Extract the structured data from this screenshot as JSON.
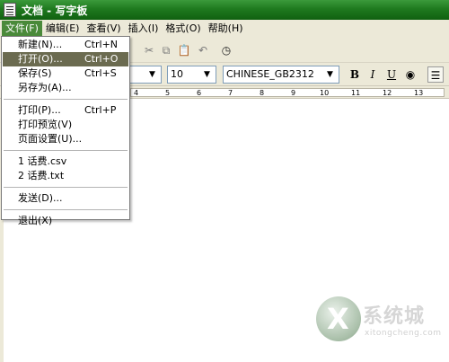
{
  "window": {
    "title": "文档 - 写字板"
  },
  "menubar": [
    "文件(F)",
    "编辑(E)",
    "查看(V)",
    "插入(I)",
    "格式(O)",
    "帮助(H)"
  ],
  "format": {
    "size": "10",
    "charset": "CHINESE_GB2312",
    "bold": "B",
    "italic": "I",
    "underline": "U"
  },
  "ruler": [
    "4",
    "5",
    "6",
    "7",
    "8",
    "9",
    "10",
    "11",
    "12",
    "13"
  ],
  "file_menu": {
    "group1": [
      {
        "label": "新建(N)...",
        "shortcut": "Ctrl+N"
      },
      {
        "label": "打开(O)...",
        "shortcut": "Ctrl+O"
      },
      {
        "label": "保存(S)",
        "shortcut": "Ctrl+S"
      },
      {
        "label": "另存为(A)...",
        "shortcut": ""
      }
    ],
    "group2": [
      {
        "label": "打印(P)...",
        "shortcut": "Ctrl+P"
      },
      {
        "label": "打印预览(V)",
        "shortcut": ""
      },
      {
        "label": "页面设置(U)...",
        "shortcut": ""
      }
    ],
    "recent": [
      "1 话费.csv",
      "2 话费.txt"
    ],
    "send": "发送(D)...",
    "exit": "退出(X)"
  },
  "watermark": {
    "title": "系统城",
    "subtitle": "xitongcheng.com"
  }
}
